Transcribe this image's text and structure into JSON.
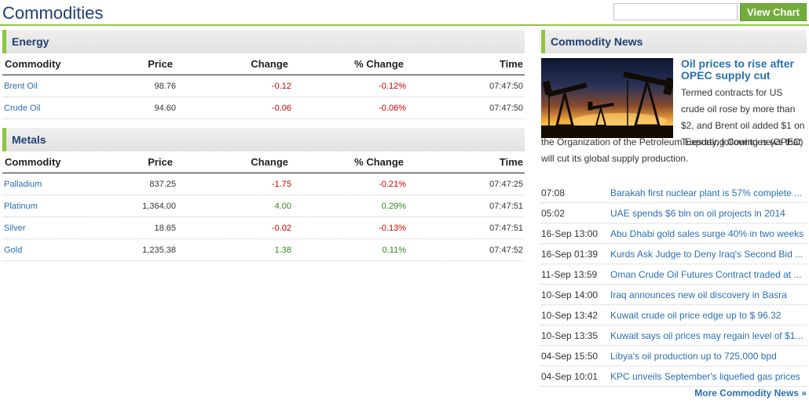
{
  "header": {
    "title": "Commodities",
    "search_value": "",
    "view_chart_label": "View Chart"
  },
  "columns": {
    "commodity": "Commodity",
    "price": "Price",
    "change": "Change",
    "pct_change": "% Change",
    "time": "Time"
  },
  "energy": {
    "title": "Energy",
    "rows": [
      {
        "name": "Brent Oil",
        "price": "98.76",
        "change": "-0.12",
        "pct": "-0.12%",
        "time": "07:47:50"
      },
      {
        "name": "Crude Oil",
        "price": "94.60",
        "change": "-0.06",
        "pct": "-0.06%",
        "time": "07:47:50"
      }
    ]
  },
  "metals": {
    "title": "Metals",
    "rows": [
      {
        "name": "Palladium",
        "price": "837.25",
        "change": "-1.75",
        "pct": "-0.21%",
        "time": "07:47:25"
      },
      {
        "name": "Platinum",
        "price": "1,364.00",
        "change": "4.00",
        "pct": "0.29%",
        "time": "07:47:51"
      },
      {
        "name": "Silver",
        "price": "18.65",
        "change": "-0.02",
        "pct": "-0.13%",
        "time": "07:47:51"
      },
      {
        "name": "Gold",
        "price": "1,235.38",
        "change": "1.38",
        "pct": "0.11%",
        "time": "07:47:52"
      }
    ]
  },
  "colors": {
    "accent_green": "#8dc63f",
    "title_navy": "#1f3f73",
    "link_blue": "#2a6fb0",
    "negative_red": "#cc0000",
    "positive_green": "#2e8a1e"
  },
  "news": {
    "title": "Commodity News",
    "feature": {
      "title": "Oil prices to rise after OPEC supply cut",
      "body_part1": "Termed contracts for US crude oil rose by more than $2, and Brent oil added $1 on Tuesday, following news that",
      "body_part2": "the Organization of the Petroleum Exporting Countries (OPEC) will cut its global supply production."
    },
    "items": [
      {
        "time": "07:08",
        "title": "Barakah first nuclear plant is 57% complete ..."
      },
      {
        "time": "05:02",
        "title": "UAE spends $6 bln on oil projects in 2014"
      },
      {
        "time": "16-Sep 13:00",
        "title": "Abu Dhabi gold sales surge 40% in two weeks"
      },
      {
        "time": "16-Sep 01:39",
        "title": "Kurds Ask Judge to Deny Iraq's Second Bid ..."
      },
      {
        "time": "11-Sep 13:59",
        "title": "Oman Crude Oil Futures Contract traded at ..."
      },
      {
        "time": "10-Sep 14:00",
        "title": "Iraq announces new oil discovery in Basra"
      },
      {
        "time": "10-Sep 13:42",
        "title": "Kuwait crude oil price edge up to $ 96.32"
      },
      {
        "time": "10-Sep 13:35",
        "title": "Kuwait says oil prices may regain level of $1..."
      },
      {
        "time": "04-Sep 15:50",
        "title": "Libya's oil production up to 725,000 bpd"
      },
      {
        "time": "04-Sep 10:01",
        "title": "KPC unveils September's liquefied gas prices"
      }
    ],
    "more_label": "More Commodity News »"
  }
}
